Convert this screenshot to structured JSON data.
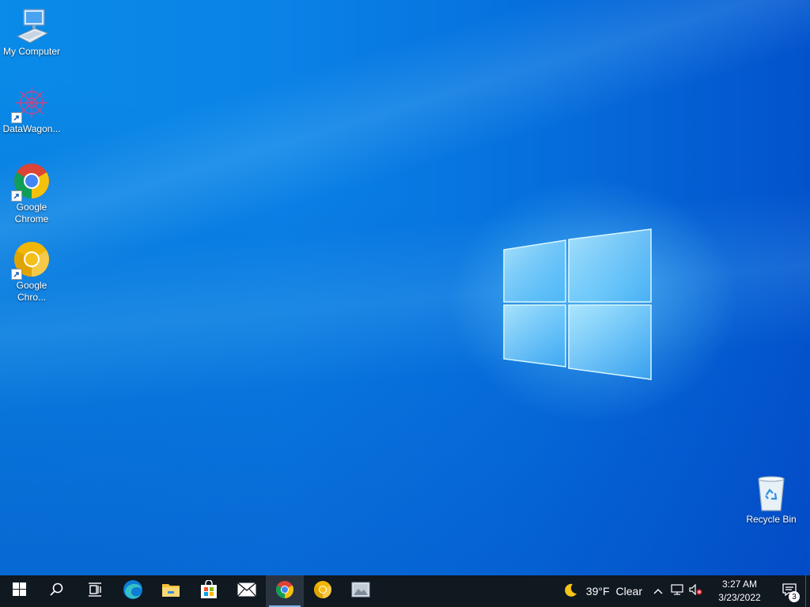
{
  "desktop_icons": [
    {
      "label": "My Computer",
      "icon": "computer-icon"
    },
    {
      "label": "DataWagon...",
      "icon": "datawagon-icon"
    },
    {
      "label": "Google Chrome",
      "icon": "chrome-icon"
    },
    {
      "label": "Google Chro...",
      "icon": "chrome-canary-icon"
    },
    {
      "label": "Recycle Bin",
      "icon": "recycle-bin-icon"
    }
  ],
  "taskbar": {
    "apps": [
      {
        "name": "start",
        "icon": "windows-start-icon"
      },
      {
        "name": "search",
        "icon": "search-icon"
      },
      {
        "name": "task-view",
        "icon": "task-view-icon"
      },
      {
        "name": "edge",
        "icon": "edge-icon"
      },
      {
        "name": "file-explorer",
        "icon": "folder-icon"
      },
      {
        "name": "store",
        "icon": "store-icon"
      },
      {
        "name": "mail",
        "icon": "mail-icon"
      },
      {
        "name": "chrome",
        "icon": "chrome-icon",
        "active": true
      },
      {
        "name": "chrome-canary",
        "icon": "chrome-canary-icon"
      },
      {
        "name": "photos",
        "icon": "photos-icon"
      }
    ],
    "weather": {
      "temp": "39°F",
      "condition": "Clear",
      "icon": "moon-icon"
    },
    "clock": {
      "time": "3:27 AM",
      "date": "3/23/2022"
    },
    "notifications": {
      "count": "3"
    }
  },
  "colors": {
    "taskbar": "#101820",
    "desktop_accent": "#0a82e6"
  }
}
